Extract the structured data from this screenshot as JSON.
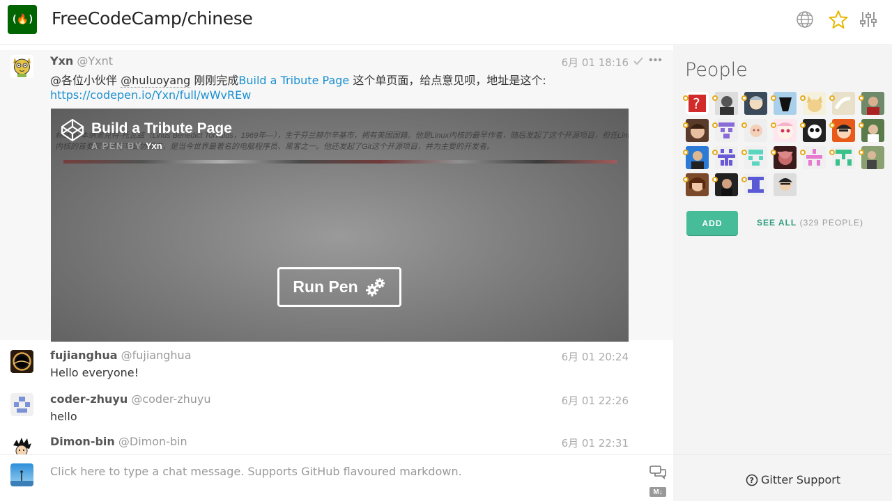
{
  "header": {
    "logo_text": "(🔥)",
    "room_title": "FreeCodeCamp/chinese",
    "icons": [
      "globe-icon",
      "star-icon",
      "settings-sliders-icon"
    ],
    "star_color": "#e6b800"
  },
  "messages": [
    {
      "name": "Yxn",
      "username": "@Yxnt",
      "time": "6月 01 18:16",
      "text_prefix": "@各位小伙伴 ",
      "mention": "@huluoyang",
      "text_mid": " 刚刚完成",
      "link_text": "Build a Tribute Page",
      "text_suffix": " 这个单页面，给点意见呗，地址是这个:",
      "url": "https://codepen.io/Yxn/full/wWvREw",
      "embed": {
        "title": "Build a Tribute Page",
        "by_label": "A PEN BY",
        "author": "Yxn",
        "run_label": "Run Pen",
        "line1": "林纳斯·本纳第克特·托瓦兹（Linus Benedict Torvalds，1969年—），生于芬兰赫尔辛基市，拥有美国国籍。他是Linux内核的最早作者，随后发起了这个开源项目，担任Linux",
        "line2": "内核的首要架构师与项目协调者，是当今世界最著名的电脑程序员、黑客之一。他还发起了Git这个开源项目，并为主要的开发者。"
      }
    },
    {
      "name": "fujianghua",
      "username": "@fujianghua",
      "time": "6月 01 20:24",
      "text": "Hello everyone!"
    },
    {
      "name": "coder-zhuyu",
      "username": "@coder-zhuyu",
      "time": "6月 01 22:26",
      "text": "hello"
    },
    {
      "name": "Dimon-bin",
      "username": "@Dimon-bin",
      "time": "6月 01 22:31",
      "text": ""
    }
  ],
  "composer": {
    "placeholder": "Click here to type a chat message. Supports GitHub flavoured markdown.",
    "icons": [
      "chat-mode-icon",
      "markdown-icon"
    ],
    "markdown_label": "M↓"
  },
  "sidebar": {
    "title": "People",
    "add_label": "ADD",
    "see_all_label": "SEE ALL",
    "see_all_count": "(329 PEOPLE)",
    "support_label": "Gitter Support",
    "accent": "#46bc99"
  }
}
